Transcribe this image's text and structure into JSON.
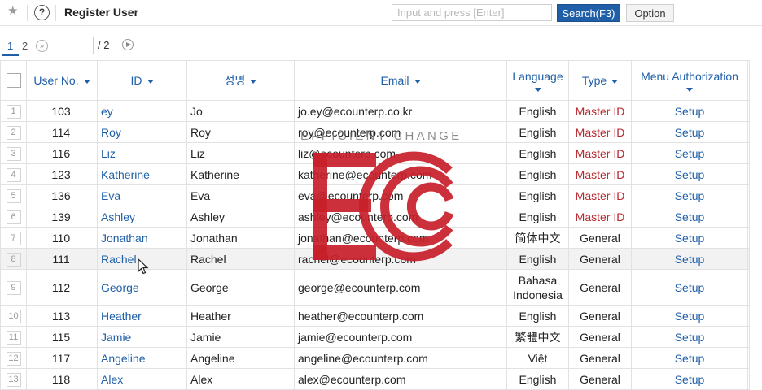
{
  "header": {
    "title": "Register User",
    "search_placeholder": "Input and press [Enter]",
    "search_button": "Search(F3)",
    "option_button": "Option",
    "help_icon_text": "?"
  },
  "pager": {
    "pages": [
      "1",
      "2"
    ],
    "current_page": "1",
    "total_label": "/ 2"
  },
  "columns": {
    "user_no": "User No.",
    "id": "ID",
    "name": "성명",
    "email": "Email",
    "language": "Language",
    "type": "Type",
    "menu_auth": "Menu Authorization"
  },
  "rows": [
    {
      "n": "1",
      "user_no": "103",
      "id": "ey",
      "name": "Jo",
      "email": "jo.ey@ecounterp.co.kr",
      "language": "English",
      "type": "Master ID",
      "auth": "Setup"
    },
    {
      "n": "2",
      "user_no": "114",
      "id": "Roy",
      "name": "Roy",
      "email": "roy@ecounterp.com",
      "language": "English",
      "type": "Master ID",
      "auth": "Setup"
    },
    {
      "n": "3",
      "user_no": "116",
      "id": "Liz",
      "name": "Liz",
      "email": "liz@ecounterp.com",
      "language": "English",
      "type": "Master ID",
      "auth": "Setup"
    },
    {
      "n": "4",
      "user_no": "123",
      "id": "Katherine",
      "name": "Katherine",
      "email": "katherine@ecounterp.com",
      "language": "English",
      "type": "Master ID",
      "auth": "Setup"
    },
    {
      "n": "5",
      "user_no": "136",
      "id": "Eva",
      "name": "Eva",
      "email": "eva@ecounterp.com",
      "language": "English",
      "type": "Master ID",
      "auth": "Setup"
    },
    {
      "n": "6",
      "user_no": "139",
      "id": "Ashley",
      "name": "Ashley",
      "email": "ashley@ecounterp.com",
      "language": "English",
      "type": "Master ID",
      "auth": "Setup"
    },
    {
      "n": "7",
      "user_no": "110",
      "id": "Jonathan",
      "name": "Jonathan",
      "email": "jonathan@ecounterp.com",
      "language": "简体中文",
      "type": "General",
      "auth": "Setup"
    },
    {
      "n": "8",
      "user_no": "111",
      "id": "Rachel",
      "name": "Rachel",
      "email": "rachel@ecounterp.com",
      "language": "English",
      "type": "General",
      "auth": "Setup"
    },
    {
      "n": "9",
      "user_no": "112",
      "id": "George",
      "name": "George",
      "email": "george@ecounterp.com",
      "language": "Bahasa Indonesia",
      "type": "General",
      "auth": "Setup"
    },
    {
      "n": "10",
      "user_no": "113",
      "id": "Heather",
      "name": "Heather",
      "email": "heather@ecounterp.com",
      "language": "English",
      "type": "General",
      "auth": "Setup"
    },
    {
      "n": "11",
      "user_no": "115",
      "id": "Jamie",
      "name": "Jamie",
      "email": "jamie@ecounterp.com",
      "language": "繁體中文",
      "type": "General",
      "auth": "Setup"
    },
    {
      "n": "12",
      "user_no": "117",
      "id": "Angeline",
      "name": "Angeline",
      "email": "angeline@ecounterp.com",
      "language": "Việt",
      "type": "General",
      "auth": "Setup"
    },
    {
      "n": "13",
      "user_no": "118",
      "id": "Alex",
      "name": "Alex",
      "email": "alex@ecounterp.com",
      "language": "English",
      "type": "General",
      "auth": "Setup"
    }
  ],
  "watermark": {
    "tagline": "EFFICIENT CHANGE",
    "letters": "EC",
    "color": "#c8202a"
  },
  "colors": {
    "accent": "#1f5fa8",
    "master_id": "#b5282e"
  }
}
